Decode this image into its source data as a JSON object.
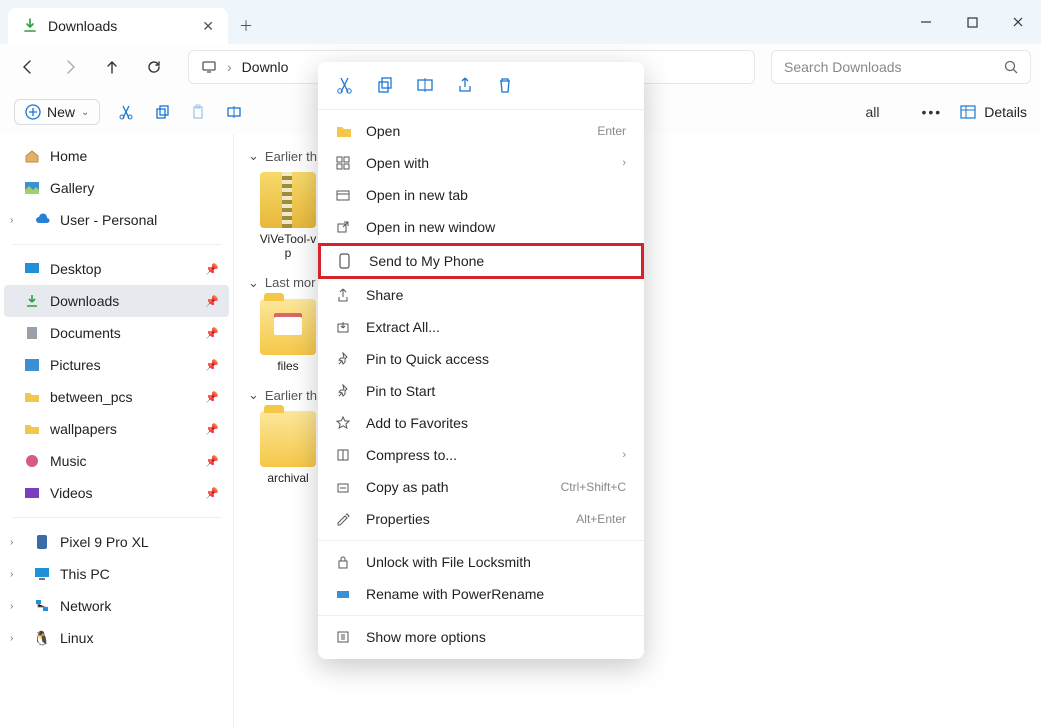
{
  "titlebar": {
    "tab_title": "Downloads"
  },
  "navbar": {
    "breadcrumb": "Downlo"
  },
  "search": {
    "placeholder": "Search Downloads"
  },
  "toolbar": {
    "new_label": "New",
    "all_label": "all",
    "details_label": "Details"
  },
  "sidebar": {
    "home": "Home",
    "gallery": "Gallery",
    "user": "User - Personal",
    "desktop": "Desktop",
    "downloads": "Downloads",
    "documents": "Documents",
    "pictures": "Pictures",
    "between": "between_pcs",
    "wallpapers": "wallpapers",
    "music": "Music",
    "videos": "Videos",
    "pixel": "Pixel 9 Pro XL",
    "thispc": "This PC",
    "network": "Network",
    "linux": "Linux"
  },
  "content": {
    "group1": "Earlier th",
    "group2": "Last mor",
    "group3": "Earlier th",
    "file1": "ViVeTool-v\np",
    "file2": "files",
    "file3": "archival"
  },
  "ctx": {
    "open": "Open",
    "open_hint": "Enter",
    "openwith": "Open with",
    "newtab": "Open in new tab",
    "newwin": "Open in new window",
    "sendphone": "Send to My Phone",
    "share": "Share",
    "extract": "Extract All...",
    "pinquick": "Pin to Quick access",
    "pinstart": "Pin to Start",
    "favorites": "Add to Favorites",
    "compress": "Compress to...",
    "copypath": "Copy as path",
    "copypath_hint": "Ctrl+Shift+C",
    "properties": "Properties",
    "properties_hint": "Alt+Enter",
    "unlock": "Unlock with File Locksmith",
    "rename": "Rename with PowerRename",
    "more": "Show more options"
  }
}
